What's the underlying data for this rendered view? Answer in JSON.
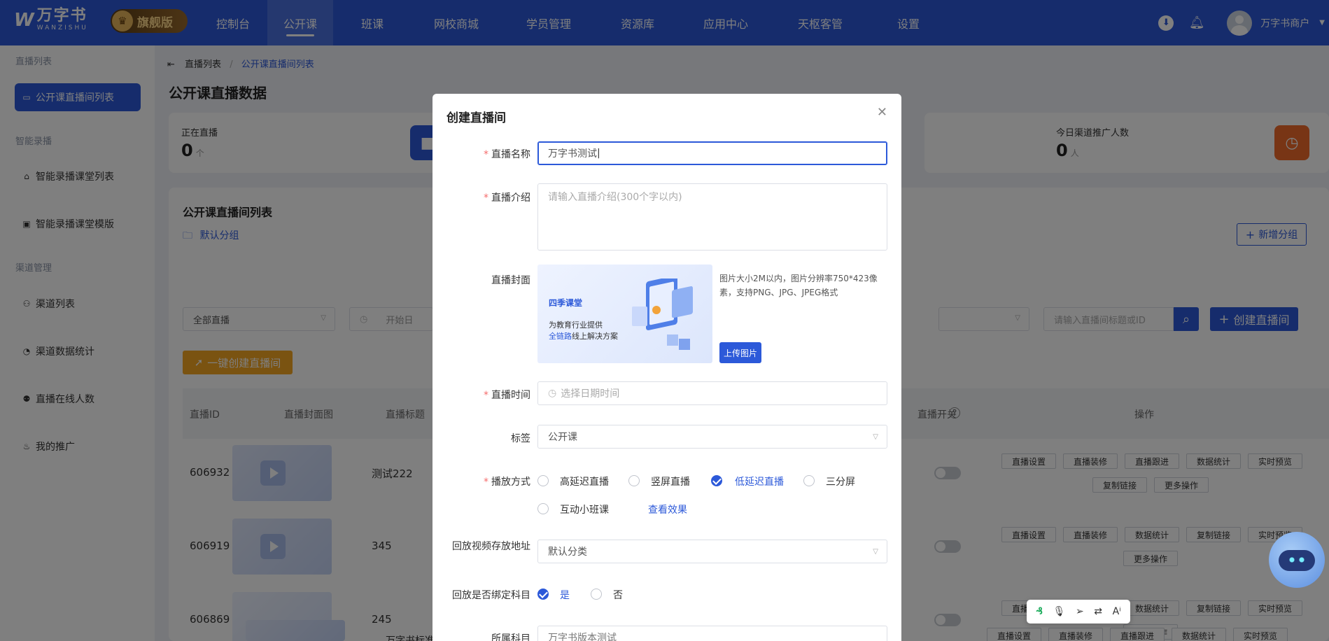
{
  "brand": {
    "mark": "W",
    "name_cn": "万字书",
    "name_en": "WANZISHU",
    "edition": "旗舰版"
  },
  "nav": [
    "控制台",
    "公开课",
    "班课",
    "网校商城",
    "学员管理",
    "资源库",
    "应用中心",
    "天枢客管",
    "设置"
  ],
  "user": {
    "name": "万字书商户"
  },
  "sidebar": {
    "g1": "直播列表",
    "i1": "公开课直播间列表",
    "g2": "智能录播",
    "i2": "智能录播课堂列表",
    "i3": "智能录播课堂模版",
    "g3": "渠道管理",
    "i4": "渠道列表",
    "i5": "渠道数据统计",
    "i6": "直播在线人数",
    "i7": "我的推广"
  },
  "breadcrumb": {
    "parent": "直播列表",
    "current": "公开课直播间列表"
  },
  "page_title": "公开课直播数据",
  "stats": {
    "live": {
      "label": "正在直播",
      "value": "0",
      "unit": "个"
    },
    "today": {
      "label": "今日渠道推广人数",
      "value": "0",
      "unit": "人"
    }
  },
  "panel": {
    "title": "公开课直播间列表",
    "folder": "默认分组",
    "add_group": "新增分组",
    "filter_all": "全部直播",
    "start_date": "开始日",
    "search_placeholder": "请输入直播间标题或ID",
    "create_btn": "创建直播间",
    "oneclick": "一键创建直播间"
  },
  "table": {
    "headers": {
      "id": "直播ID",
      "cover": "直播封面图",
      "title": "直播标题",
      "switch": "直播开关",
      "ops": "操作"
    },
    "rows": [
      {
        "id": "606932",
        "title": "测试222"
      },
      {
        "id": "606919",
        "title": "345"
      },
      {
        "id": "606869",
        "title": "245"
      },
      {
        "id": "",
        "title": "万字书标准"
      }
    ],
    "ops": {
      "settings": "直播设置",
      "decor": "直播装修",
      "follow": "直播跟进",
      "stats": "数据统计",
      "preview": "实时预览",
      "copy": "复制链接",
      "more": "更多操作"
    }
  },
  "modal": {
    "title": "创建直播间",
    "name_label": "直播名称",
    "name_value": "万字书测试",
    "intro_label": "直播介绍",
    "intro_placeholder": "请输入直播介绍(300个字以内)",
    "cover_label": "直播封面",
    "cover_brand": "四季课堂",
    "cover_line1": "为教育行业提供",
    "cover_line2a": "全链路",
    "cover_line2b": "线上解决方案",
    "upload_tip": "图片大小2M以内，图片分辨率750*423像素，支持PNG、JPG、JPEG格式",
    "upload_btn": "上传图片",
    "time_label": "直播时间",
    "time_placeholder": "选择日期时间",
    "tag_label": "标签",
    "tag_value": "公开课",
    "play_label": "播放方式",
    "play_opts": [
      "高延迟直播",
      "竖屏直播",
      "低延迟直播",
      "三分屏",
      "互动小班课"
    ],
    "view_effect": "查看效果",
    "replay_label": "回放视频存放地址",
    "replay_value": "默认分类",
    "bind_label": "回放是否绑定科目",
    "bind_yes": "是",
    "bind_no": "否",
    "subject_label": "所属科目",
    "subject_value": "万字书版本测试"
  },
  "colors": {
    "primary": "#2c59d9",
    "orange": "#f5a623",
    "green": "#1fa56a",
    "warn": "#f06a2b"
  }
}
